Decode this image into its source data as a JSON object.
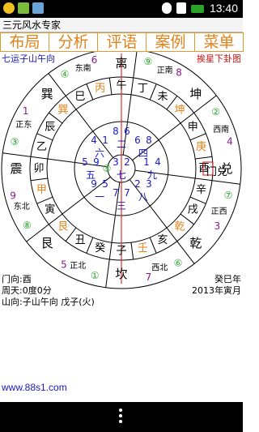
{
  "status_bar": {
    "time": "13:40"
  },
  "app_title": "三元风水专家",
  "menu": [
    "布局",
    "分析",
    "评语",
    "案例",
    "菜单"
  ],
  "header": {
    "left": "七运子山午向",
    "right": "挨星下卦图"
  },
  "outer_directions": {
    "south": "离",
    "southeast": "巽",
    "east": "震",
    "northeast": "艮",
    "north": "坎",
    "northwest": "乾",
    "west": "兑",
    "southwest": "坤"
  },
  "outer_numbers": {
    "south": "6",
    "southeast": "1",
    "east": "9",
    "northeast": "5",
    "north": "7",
    "northwest": "3",
    "west": "4",
    "southwest": "8"
  },
  "circled_numbers": {
    "south": "⑨",
    "southeast": "④",
    "east": "③",
    "northeast": "⑧",
    "north": "①",
    "northwest": "⑥",
    "west": "⑦",
    "southwest": "②",
    "center": "⑤"
  },
  "quarter_labels": {
    "south": "正南",
    "southwest": "西南",
    "west": "正西",
    "northwest": "西北",
    "north": "正北",
    "northeast": "东北",
    "east": "正东",
    "southeast": "东南"
  },
  "mountains": {
    "wu": "午",
    "ding": "丁",
    "wei": "未",
    "kun": "坤",
    "shen": "申",
    "geng": "庚",
    "you": "酉",
    "xin": "辛",
    "xu": "戌",
    "qian": "乾",
    "hai": "亥",
    "ren": "壬",
    "zi": "子",
    "gui": "癸",
    "chou": "丑",
    "gen": "艮",
    "yin": "寅",
    "jia": "甲",
    "mao": "卯",
    "yi": "乙",
    "chen": "辰",
    "xun": "巽",
    "si": "巳",
    "bing": "丙"
  },
  "door_label": "门兑",
  "palaces": [
    {
      "pos": "S",
      "mountain": "8",
      "water": "6",
      "base": "二"
    },
    {
      "pos": "SW",
      "mountain": "6",
      "water": "8",
      "base": "四"
    },
    {
      "pos": "W",
      "mountain": "1",
      "water": "4",
      "base": "九"
    },
    {
      "pos": "NW",
      "mountain": "2",
      "water": "3",
      "base": "八"
    },
    {
      "pos": "N",
      "mountain": "7",
      "water": "7",
      "base": "三"
    },
    {
      "pos": "NE",
      "mountain": "9",
      "water": "5",
      "base": "一"
    },
    {
      "pos": "E",
      "mountain": "5",
      "water": "9",
      "base": "五"
    },
    {
      "pos": "SE",
      "mountain": "4",
      "water": "1",
      "base": "六"
    },
    {
      "pos": "C",
      "mountain": "3",
      "water": "2",
      "base": "七"
    }
  ],
  "info": {
    "door": "门向:酉",
    "zhoutian": "周天:0度0分",
    "shanxiang": "山向:子山午向 戊子(火)",
    "year1": "癸巳年",
    "year2": "2013年寅月"
  },
  "website": "www.88s1.com"
}
